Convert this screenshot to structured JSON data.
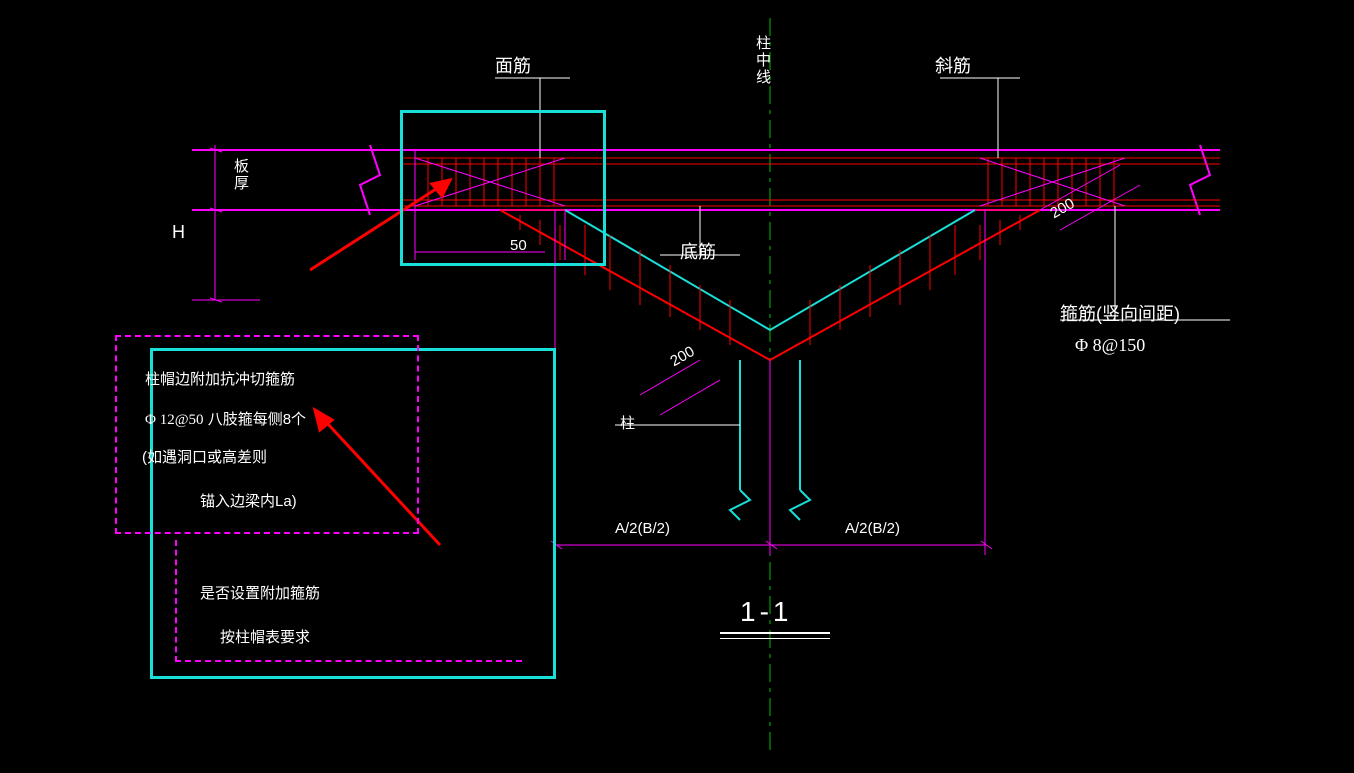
{
  "labels": {
    "top_rebar": "面筋",
    "col_center": "柱中线",
    "diag_rebar": "斜筋",
    "slab_thick": "板厚",
    "H": "H",
    "bottom_rebar": "底筋",
    "fifty": "50",
    "column": "柱",
    "span_left": "A/2(B/2)",
    "span_right": "A/2(B/2)",
    "dim200a": "200",
    "dim200b": "200",
    "stirrup_title": "箍筋(竖向间距)",
    "stirrup_spec": "Φ 8@150"
  },
  "section_title": "1-1",
  "notes": {
    "n1": "柱帽边附加抗冲切箍筋",
    "n2_a": "Φ 12@50",
    "n2_b": "八肢箍每侧8个",
    "n3": "(如遇洞口或高差则",
    "n4": "锚入边梁内La)",
    "n5": "是否设置附加箍筋",
    "n6": "按柱帽表要求"
  },
  "colors": {
    "magenta": "#f0f",
    "red": "#f00",
    "cyan": "#18e0d8",
    "green": "#0b0",
    "white": "#fff"
  }
}
